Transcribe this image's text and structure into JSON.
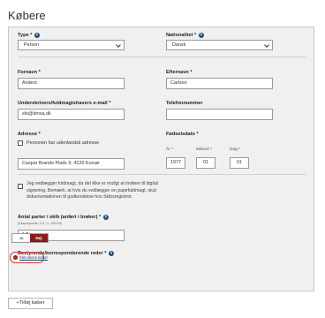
{
  "page": {
    "title": "Købere"
  },
  "form": {
    "type": {
      "label": "Type",
      "required_mark": "*",
      "value": "Person"
    },
    "nationality": {
      "label": "Nationalitet",
      "required_mark": "*",
      "value": "Dansk"
    },
    "first_name": {
      "label": "Fornavn",
      "required_mark": "*",
      "value": "Anders"
    },
    "last_name": {
      "label": "Efternavn",
      "required_mark": "*",
      "value": "Carlsen"
    },
    "email": {
      "label": "Underskrivers/fuldmagtshavers e-mail",
      "required_mark": "*",
      "value": "sfs@dmsa.dk"
    },
    "phone": {
      "label": "Telefonnummer",
      "value": ""
    },
    "address": {
      "label": "Adresse",
      "required_mark": "*",
      "foreign_checkbox_label": "Personen har udenlandsk adresse",
      "foreign_checked": false,
      "value": "Caspar Brands Plads 9, 4220 Korsør"
    },
    "birthdate": {
      "label": "Fødselsdato",
      "required_mark": "*",
      "year_label": "År",
      "year_value": "1977",
      "month_label": "Måned",
      "month_value": "01",
      "day_label": "Dag",
      "day_value": "01",
      "required_mark_small": "*"
    },
    "proxy": {
      "checked": false,
      "lines": [
        "Jeg vedlægger fuldmagt, da det ikke er muligt at invitere til digital",
        "signering. Bemærk, at hvis du vedlægger en papirfuldmagt, skal",
        "dokumentationen til godkendelse hos Skibsregistret."
      ]
    },
    "share": {
      "label": "Antal parter i skib (anført i brøker)",
      "required_mark": "*",
      "hint": "(Eksempelvis: 1/4, ¼, 25/100)",
      "value": "1/2"
    },
    "manager": {
      "label": "Bestyrende/korresponderende reder",
      "required_mark": "*",
      "yes_label": "Ja",
      "no_label": "Nej",
      "selected": "Nej"
    },
    "delete_link": "Slet denne køber"
  },
  "actions": {
    "add_buyer": "+Tilføj køber"
  },
  "colors": {
    "accent": "#1f4e79",
    "selected_toggle": "#8c1a1a",
    "highlight_ring": "#d9413b",
    "panel_bg": "#f0f0f0"
  }
}
